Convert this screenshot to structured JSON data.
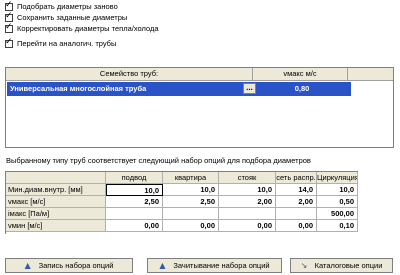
{
  "checkboxes": [
    {
      "label": "Подобрать диаметры заново",
      "checked": true
    },
    {
      "label": "Сохранить заданные диаметры",
      "checked": true
    },
    {
      "label": "Корректировать диаметры тепла/холода",
      "checked": true
    },
    {
      "label": "Перейти на аналогич. трубы",
      "checked": true
    }
  ],
  "family_table": {
    "col_family": "Семейство труб:",
    "col_vmax": "vмакс м/с",
    "selected_name": "Универсальная многослойная труба",
    "dots_label": "...",
    "selected_vmax": "0,80"
  },
  "description": "Выбранному типу труб соответствует следующий набор опций для подбора диаметров",
  "options": {
    "columns": [
      "подвод",
      "квартира",
      "стояк",
      "сеть распр.",
      "Циркуляция"
    ],
    "rows": [
      {
        "label": "Мин.диам.внутр. [мм]",
        "values": [
          "10,0",
          "10,0",
          "10,0",
          "14,0",
          "10,0"
        ]
      },
      {
        "label": "vмакс [м/с]",
        "values": [
          "2,50",
          "2,50",
          "2,00",
          "2,00",
          "0,50"
        ]
      },
      {
        "label": "iмакс [Па/м]",
        "values": [
          "",
          "",
          "",
          "",
          "500,00"
        ]
      },
      {
        "label": "vмин [м/с]",
        "values": [
          "0,00",
          "0,00",
          "0,00",
          "0,00",
          "0,10"
        ]
      }
    ]
  },
  "buttons": {
    "save": "Запись набора опций",
    "read": "Зачитывание набора опций",
    "catalog": "Каталоговые опции"
  }
}
